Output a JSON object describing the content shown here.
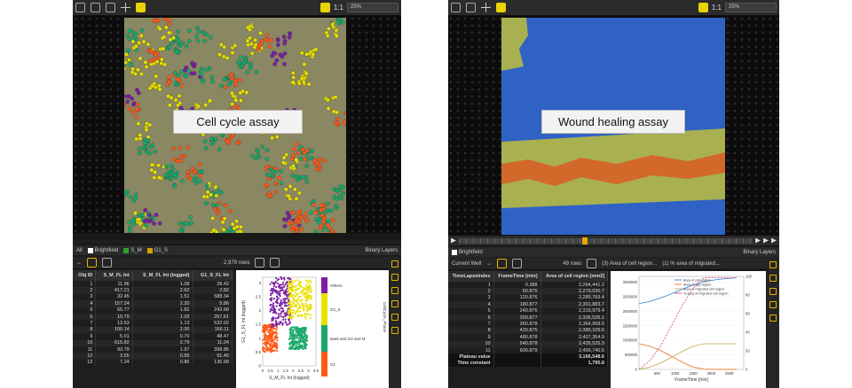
{
  "left": {
    "zoom": "25%",
    "overlay_label": "Cell cycle assay",
    "tabs": [
      "All",
      "Brightfield",
      "S_M",
      "G1_S"
    ],
    "tab_colors": [
      "#ffffff",
      "#2ca02c",
      "#d4a200"
    ],
    "binary_layers": "Binary Layers",
    "rows_count": "2,979 rows",
    "table_columns": [
      "Obj ID",
      "S_M_FL Int",
      "S_M_FL Int (logged)",
      "G1_S_FL Int"
    ],
    "table_rows": [
      [
        "1",
        "11.96",
        "1.08",
        "28.42"
      ],
      [
        "2",
        "417.21",
        "2.62",
        "2.82"
      ],
      [
        "3",
        "32.45",
        "1.51",
        "588.34"
      ],
      [
        "4",
        "157.24",
        "2.20",
        "5.86"
      ],
      [
        "5",
        "65.77",
        "1.82",
        "243.68"
      ],
      [
        "6",
        "10.79",
        "1.03",
        "267.61"
      ],
      [
        "7",
        "13.53",
        "1.13",
        "532.02"
      ],
      [
        "8",
        "100.14",
        "2.00",
        "166.11"
      ],
      [
        "9",
        "5.01",
        "0.70",
        "48.47"
      ],
      [
        "10",
        "615.82",
        "2.79",
        "11.24"
      ],
      [
        "11",
        "93.79",
        "1.97",
        "398.86"
      ],
      [
        "12",
        "3.55",
        "0.55",
        "91.45"
      ],
      [
        "13",
        "7.24",
        "0.86",
        "136.68"
      ]
    ],
    "scatter": {
      "ylabel": "G1_S_FL Int (logged)",
      "xlabel": "S_M_FL Int (logged)",
      "x_ticks": [
        "0",
        "0.5",
        "1",
        "1.5",
        "2",
        "2.5",
        "3",
        "3.5"
      ],
      "y_ticks": [
        "0",
        "0.5",
        "1",
        "1.5",
        "2",
        "2.5",
        "3"
      ],
      "legend": [
        {
          "label": "Others",
          "color": "#7a1fa2"
        },
        {
          "label": "G2_S",
          "color": "#e8e000"
        },
        {
          "label": "late5 and G2 and M",
          "color": "#1aa86a"
        },
        {
          "label": "G1",
          "color": "#ff5a1a"
        }
      ],
      "legend_title": "CellCycle_Phase"
    }
  },
  "right": {
    "zoom": "25%",
    "overlay_label": "Wound healing assay",
    "tabs": [
      "Brightfield"
    ],
    "binary_layers": "Binary Layers",
    "well_label": "Current Well",
    "rows_count": "49 rows",
    "dropdown1": "(3) Area of cell region...",
    "dropdown2": "(1) % area of migrated...",
    "table_columns": [
      "TimeLapseIndex",
      "FrameTime [min]",
      "Area of cell region [mm2]"
    ],
    "table_rows": [
      [
        "1",
        "0.388",
        "2,264,441.2"
      ],
      [
        "2",
        "60.875",
        "2,279,030.7"
      ],
      [
        "3",
        "120.876",
        "2,289,769.4"
      ],
      [
        "4",
        "180.877",
        "2,301,883.7"
      ],
      [
        "5",
        "240.876",
        "2,319,979.4"
      ],
      [
        "6",
        "300.877",
        "2,336,526.1"
      ],
      [
        "7",
        "360.878",
        "2,364,968.9"
      ],
      [
        "8",
        "420.875",
        "2,385,105.5"
      ],
      [
        "9",
        "480.878",
        "2,407,354.9"
      ],
      [
        "10",
        "540.878",
        "2,435,525.3"
      ],
      [
        "11",
        "600.879",
        "2,459,740.5"
      ]
    ],
    "summary_rows": [
      [
        "Plateau value",
        "",
        "3,166,548.6"
      ],
      [
        "Time constant",
        "",
        "1,795.8"
      ]
    ],
    "chart_data": {
      "type": "line",
      "xlabel": "FrameTime [min]",
      "x_ticks": [
        "500",
        "1000",
        "1500",
        "2000",
        "2500"
      ],
      "y_left_ticks": [
        "0",
        "500000",
        "1000000",
        "1500000",
        "2000000",
        "2500000",
        "3000000"
      ],
      "y_right_ticks": [
        "0",
        "20",
        "40",
        "60",
        "80",
        "100"
      ],
      "xlim": [
        0,
        2900
      ],
      "ylim": [
        0,
        3200000
      ],
      "series": [
        {
          "name": "Area of cell region",
          "color": "#4a90d9",
          "x": [
            0,
            300,
            600,
            900,
            1200,
            1500,
            1800,
            2100,
            2400,
            2700
          ],
          "y": [
            2264441,
            2336526,
            2459740,
            2600000,
            2760000,
            2900000,
            3020000,
            3080000,
            3120000,
            3150000
          ]
        },
        {
          "name": "Area of gap region",
          "color": "#e8823a",
          "x": [
            0,
            300,
            600,
            900,
            1200,
            1500,
            1800,
            2100,
            2400,
            2700
          ],
          "y": [
            880000,
            800000,
            650000,
            450000,
            250000,
            80000,
            10000,
            0,
            0,
            0
          ]
        },
        {
          "name": "Area of migrated cell region",
          "color": "#c8b060",
          "x": [
            0,
            300,
            600,
            900,
            1200,
            1500,
            1800,
            2100,
            2400,
            2700
          ],
          "y": [
            0,
            80000,
            220000,
            420000,
            620000,
            800000,
            880000,
            880000,
            880000,
            880000
          ]
        },
        {
          "name": "% area of migrated cell region",
          "color": "#e05080",
          "dashed": true,
          "x": [
            0,
            300,
            600,
            900,
            1200,
            1500,
            1800,
            2100,
            2400,
            2700
          ],
          "y": [
            0,
            300000,
            800000,
            1500000,
            2200000,
            2800000,
            3150000,
            3150000,
            3150000,
            3150000
          ]
        }
      ]
    }
  }
}
